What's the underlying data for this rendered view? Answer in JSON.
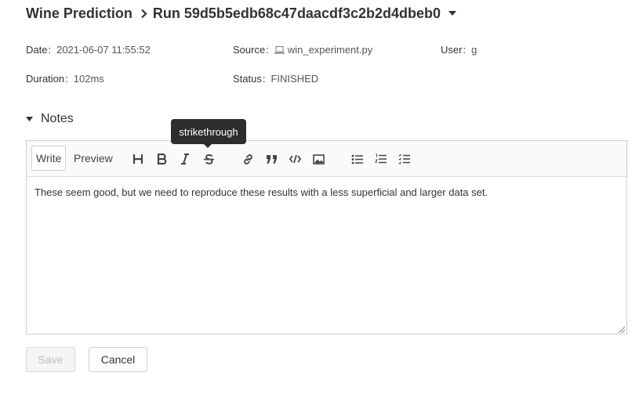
{
  "breadcrumb": {
    "experiment": "Wine Prediction",
    "run": "Run 59d5b5edb68c47daacdf3c2b2d4dbeb0"
  },
  "metadata": {
    "date_label": "Date",
    "date_value": "2021-06-07 11:55:52",
    "source_label": "Source",
    "source_value": "win_experiment.py",
    "user_label": "User",
    "user_value": "g",
    "duration_label": "Duration",
    "duration_value": "102ms",
    "status_label": "Status",
    "status_value": "FINISHED"
  },
  "notes": {
    "header": "Notes",
    "tabs": {
      "write": "Write",
      "preview": "Preview"
    },
    "toolbar_icons": [
      "header-icon",
      "bold-icon",
      "italic-icon",
      "strikethrough-icon",
      "link-icon",
      "quote-icon",
      "code-icon",
      "image-icon",
      "unordered-list-icon",
      "ordered-list-icon",
      "checklist-icon"
    ],
    "tooltip": "strikethrough",
    "content": "These seem good, but we need to reproduce these results with a less superficial and larger data set."
  },
  "actions": {
    "save": "Save",
    "cancel": "Cancel"
  },
  "colors": {
    "text": "#333333",
    "tooltip_bg": "#2d2d2d",
    "toolbar_bg": "#fafafa",
    "border": "#cfcfcf",
    "disabled_text": "#bdbdbd"
  }
}
